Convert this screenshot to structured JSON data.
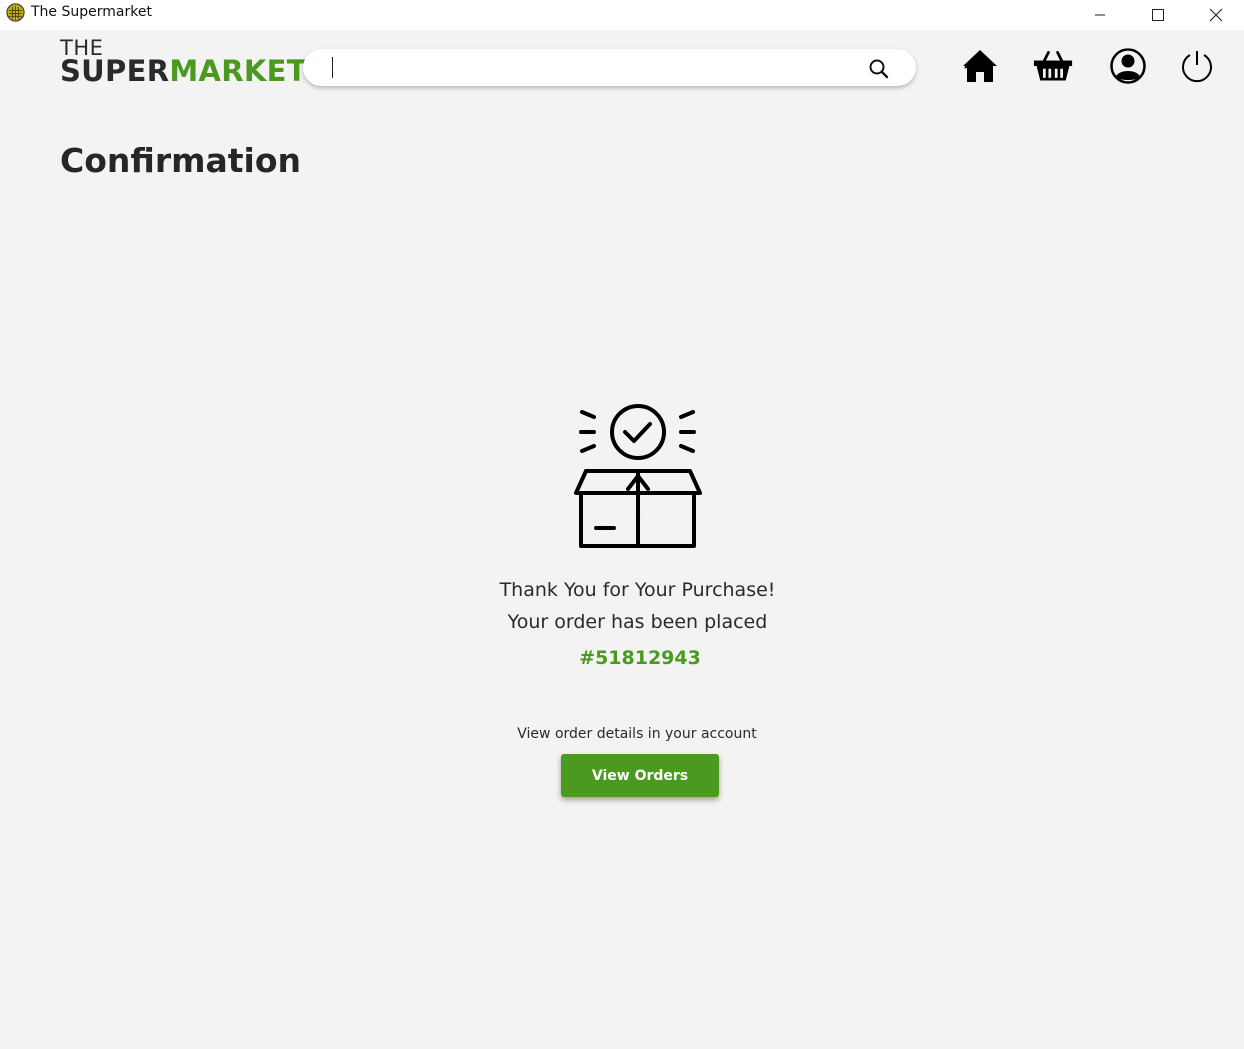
{
  "window": {
    "title": "The Supermarket",
    "controls": [
      "minimize-icon",
      "maximize-icon",
      "close-icon"
    ]
  },
  "header": {
    "logo": {
      "line1": "THE",
      "part1": "SUPER",
      "part2": "MARKET"
    },
    "search": {
      "value": "",
      "placeholder": "",
      "icon": "search-icon"
    },
    "nav": [
      {
        "name": "home-icon"
      },
      {
        "name": "basket-icon"
      },
      {
        "name": "account-icon"
      },
      {
        "name": "power-icon"
      }
    ]
  },
  "main": {
    "page_title": "Confirmation",
    "illustration": "order-box-check-icon",
    "thanks_line1": "Thank You for Your Purchase!",
    "thanks_line2": "Your order has been placed",
    "order_number": "#51812943",
    "details_note": "View order details in your account",
    "view_orders_label": "View Orders"
  },
  "colors": {
    "accent": "#4a9a1f",
    "background": "#f3f3f3",
    "text": "#262626"
  }
}
